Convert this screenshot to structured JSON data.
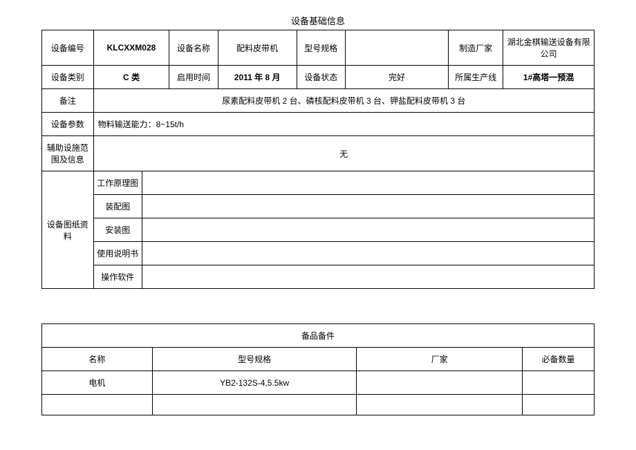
{
  "table1": {
    "title": "设备基础信息",
    "row1": {
      "label1": "设备编号",
      "value1": "KLCXXM028",
      "label2": "设备名称",
      "value2": "配料皮带机",
      "label3": "型号规格",
      "value3": "",
      "label4": "制造厂家",
      "value4": "湖北金棋输送设备有限公司"
    },
    "row2": {
      "label1": "设备类别",
      "value1": "C 类",
      "label2": "启用时间",
      "value2": "2011 年 8 月",
      "label3": "设备状态",
      "value3": "完好",
      "label4": "所属生产线",
      "value4": "1#高塔一预混"
    },
    "row3": {
      "label": "备注",
      "value": "尿素配料皮带机 2 台、磷核配料皮带机 3 台、钾盐配料皮带机 3 台"
    },
    "row4": {
      "label": "设备参数",
      "value": "物料输送能力：8~15t/h"
    },
    "row5": {
      "label": "辅助设施范围及信息",
      "value": "无"
    },
    "drawings": {
      "label": "设备图纸资料",
      "items": [
        "工作原理图",
        "装配图",
        "安装图",
        "使用说明书",
        "操作软件"
      ]
    }
  },
  "table2": {
    "title": "备品备件",
    "headers": {
      "name": "名称",
      "model": "型号规格",
      "vendor": "厂家",
      "qty": "必备数量"
    },
    "rows": [
      {
        "name": "电机",
        "model": "YB2-132S-4,5.5kw",
        "vendor": "",
        "qty": ""
      },
      {
        "name": "",
        "model": "",
        "vendor": "",
        "qty": ""
      }
    ]
  }
}
